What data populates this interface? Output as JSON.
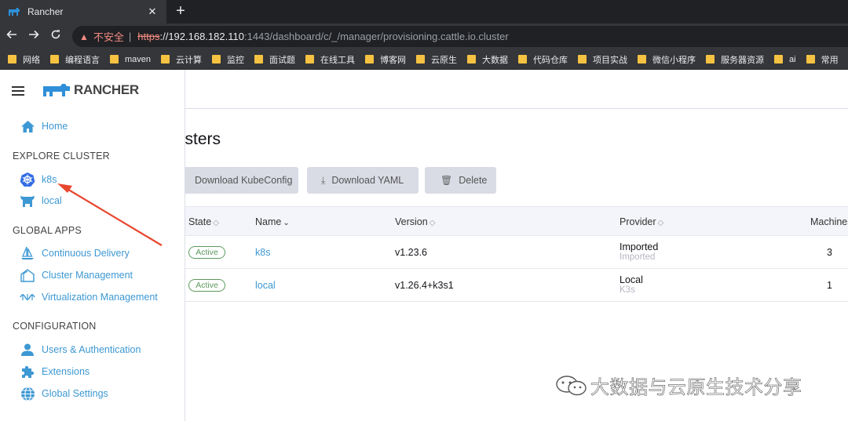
{
  "browser": {
    "tab_title": "Rancher",
    "close_glyph": "✕",
    "newtab_glyph": "+",
    "insecure_label": "不安全",
    "url_scheme": "https",
    "url_host": "://192.168.182.110",
    "url_rest": ":1443/dashboard/c/_/manager/provisioning.cattle.io.cluster"
  },
  "bookmarks": [
    "网络",
    "编程语言",
    "maven",
    "云计算",
    "监控",
    "面试题",
    "在线工具",
    "博客网",
    "云原生",
    "大数据",
    "代码仓库",
    "项目实战",
    "微信小程序",
    "服务器资源",
    "ai",
    "常用"
  ],
  "sidebar": {
    "logo_text": "RANCHER",
    "home": "Home",
    "explore_title": "EXPLORE CLUSTER",
    "clusters": [
      "k8s",
      "local"
    ],
    "global_apps_title": "GLOBAL APPS",
    "global_apps": [
      "Continuous Delivery",
      "Cluster Management",
      "Virtualization Management"
    ],
    "configuration_title": "CONFIGURATION",
    "configuration": [
      "Users & Authentication",
      "Extensions",
      "Global Settings"
    ]
  },
  "main": {
    "heading": "Clusters",
    "buttons": {
      "kubeconfig": "Download KubeConfig",
      "yaml": "Download YAML",
      "delete": "Delete"
    },
    "columns": {
      "state": "State",
      "name": "Name",
      "version": "Version",
      "provider": "Provider",
      "machines": "Machines"
    },
    "rows": [
      {
        "state": "Active",
        "name": "k8s",
        "version": "v1.23.6",
        "provider": "Imported",
        "provider_sub": "Imported",
        "machines": "3"
      },
      {
        "state": "Active",
        "name": "local",
        "version": "v1.26.4+k3s1",
        "provider": "Local",
        "provider_sub": "K3s",
        "machines": "1"
      }
    ]
  },
  "watermark": "大数据与云原生技术分享",
  "colors": {
    "accent": "#3d98d3",
    "active_badge": "#5d995d",
    "annotation_arrow": "#e8472f"
  }
}
